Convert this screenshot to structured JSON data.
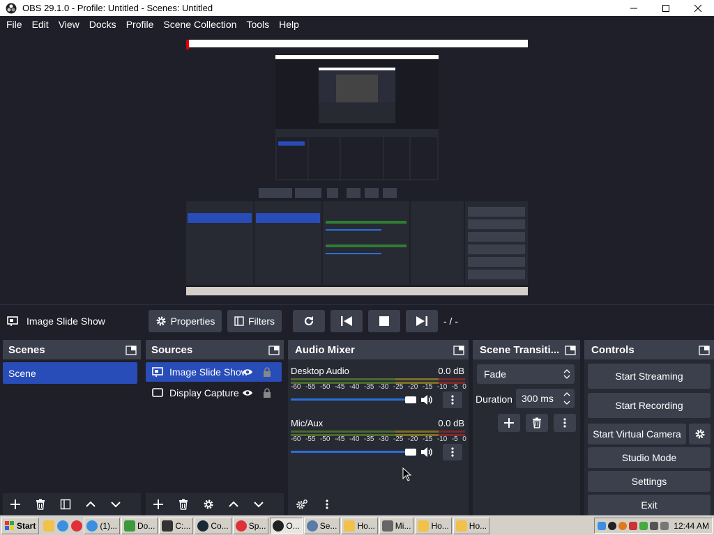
{
  "window": {
    "title": "OBS 29.1.0 - Profile: Untitled - Scenes: Untitled"
  },
  "menu": [
    "File",
    "Edit",
    "View",
    "Docks",
    "Profile",
    "Scene Collection",
    "Tools",
    "Help"
  ],
  "context_bar": {
    "source_name": "Image Slide Show",
    "properties_label": "Properties",
    "filters_label": "Filters",
    "slide_counter": "- / -"
  },
  "scenes": {
    "title": "Scenes",
    "items": [
      "Scene"
    ]
  },
  "sources": {
    "title": "Sources",
    "items": [
      "Image Slide Show",
      "Display Capture"
    ]
  },
  "audio_mixer": {
    "title": "Audio Mixer",
    "scale": [
      "-60",
      "-55",
      "-50",
      "-45",
      "-40",
      "-35",
      "-30",
      "-25",
      "-20",
      "-15",
      "-10",
      "-5",
      "0"
    ],
    "channels": [
      {
        "name": "Desktop Audio",
        "level": "0.0 dB"
      },
      {
        "name": "Mic/Aux",
        "level": "0.0 dB"
      }
    ]
  },
  "transitions": {
    "title": "Scene Transiti...",
    "selected": "Fade",
    "duration_label": "Duration",
    "duration_value": "300 ms"
  },
  "controls": {
    "title": "Controls",
    "start_streaming": "Start Streaming",
    "start_recording": "Start Recording",
    "start_virtual_camera": "Start Virtual Camera",
    "studio_mode": "Studio Mode",
    "settings": "Settings",
    "exit": "Exit"
  },
  "taskbar": {
    "start_label": "Start",
    "items": [
      "(1)...",
      "Do...",
      "C:...",
      "Co...",
      "Sp...",
      "O...",
      "Se...",
      "Ho...",
      "Mi...",
      "Ho...",
      "Ho..."
    ],
    "clock": "12:44 AM"
  },
  "colors": {
    "accent": "#284cb8",
    "panel": "#272a33",
    "background": "#1e1f29",
    "button": "#3c404d"
  }
}
